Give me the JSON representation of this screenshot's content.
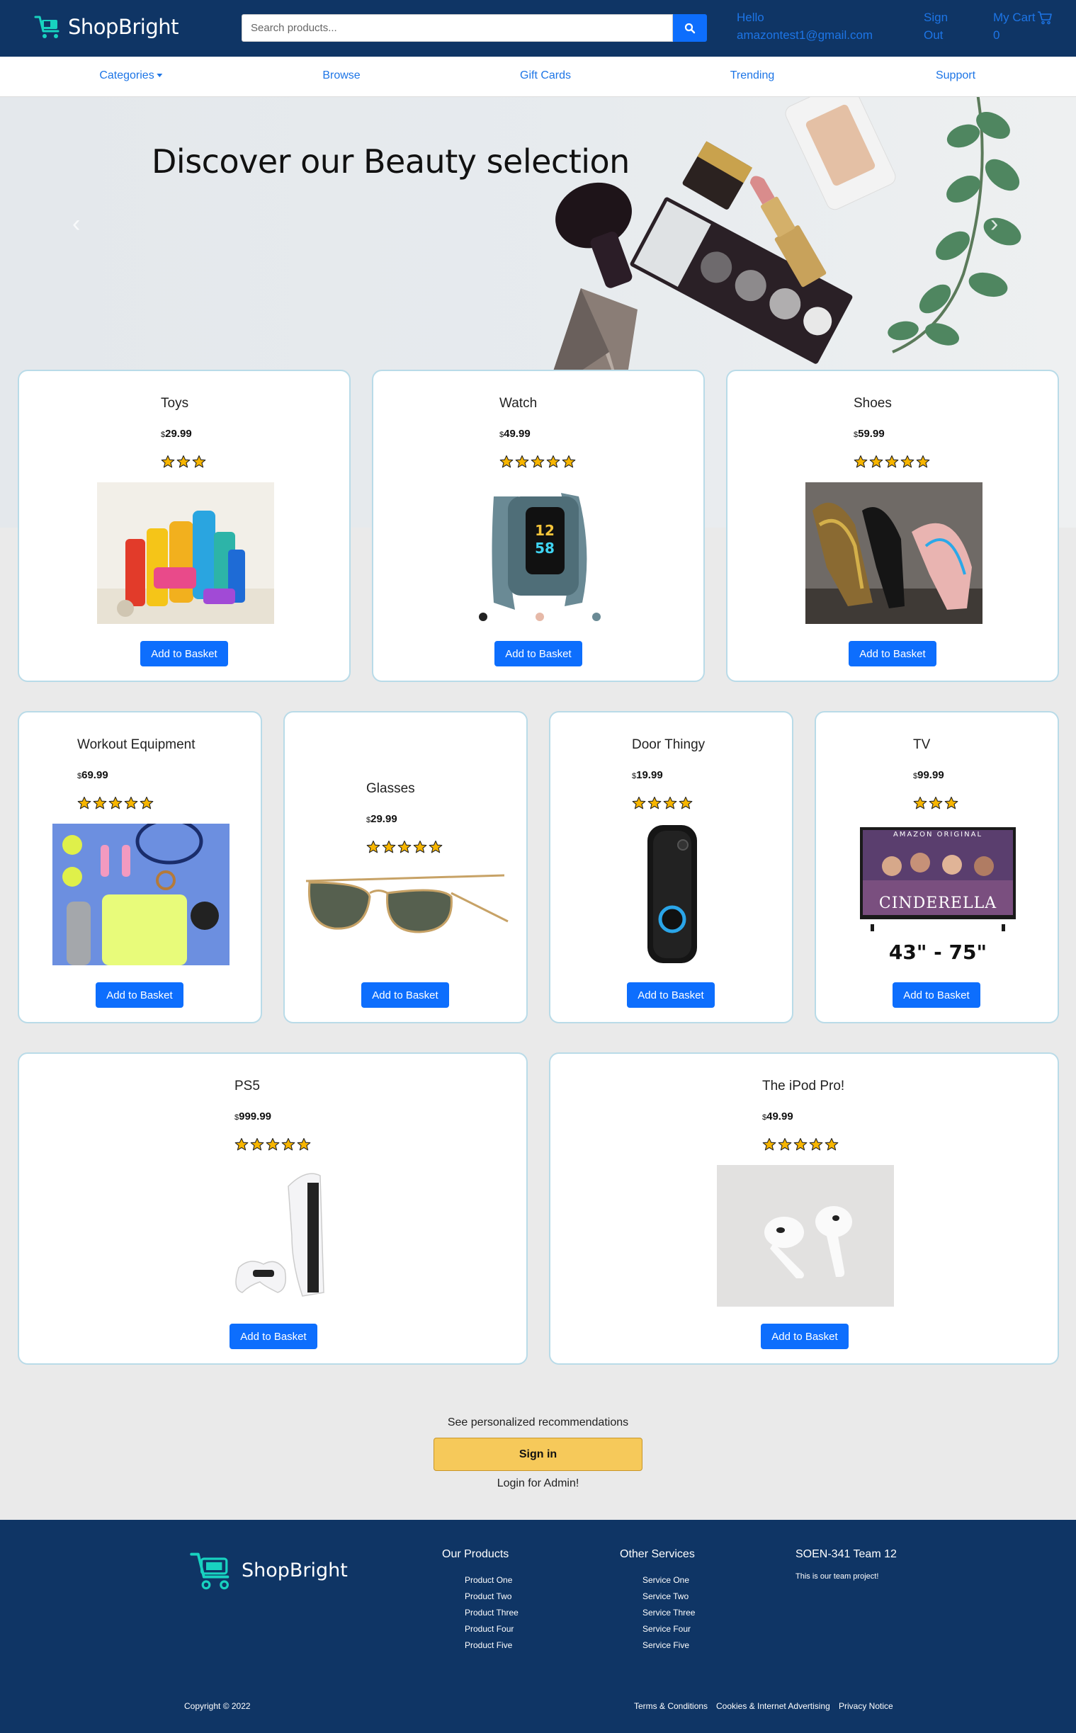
{
  "header": {
    "brand": "ShopBright",
    "search_placeholder": "Search products...",
    "hello_line1": "Hello",
    "hello_line2": "amazontest1@gmail.com",
    "signout_line1": "Sign",
    "signout_line2": "Out",
    "cart_label": "My Cart",
    "cart_count": "0",
    "colors": {
      "bar": "#0f3565",
      "link": "#1d75e6",
      "button": "#0d6efd"
    }
  },
  "nav": {
    "items": [
      {
        "label": "Categories"
      },
      {
        "label": "Browse"
      },
      {
        "label": "Gift Cards"
      },
      {
        "label": "Trending"
      },
      {
        "label": "Support"
      }
    ]
  },
  "hero": {
    "title": "Discover our Beauty selection",
    "prev_icon": "chevron-left-icon",
    "next_icon": "chevron-right-icon"
  },
  "products": [
    {
      "title": "Toys",
      "currency": "$",
      "price": "29.99",
      "rating": 3,
      "button": "Add to Basket",
      "image": "toys-photo"
    },
    {
      "title": "Watch",
      "currency": "$",
      "price": "49.99",
      "rating": 5,
      "button": "Add to Basket",
      "image": "watch-photo"
    },
    {
      "title": "Shoes",
      "currency": "$",
      "price": "59.99",
      "rating": 5,
      "button": "Add to Basket",
      "image": "shoes-photo"
    },
    {
      "title": "Workout Equipment",
      "currency": "$",
      "price": "69.99",
      "rating": 5,
      "button": "Add to Basket",
      "image": "workout-photo"
    },
    {
      "title": "Glasses",
      "currency": "$",
      "price": "29.99",
      "rating": 5,
      "button": "Add to Basket",
      "image": "glasses-photo"
    },
    {
      "title": "Door Thingy",
      "currency": "$",
      "price": "19.99",
      "rating": 4,
      "button": "Add to Basket",
      "image": "doorbell-photo"
    },
    {
      "title": "TV",
      "currency": "$",
      "price": "99.99",
      "rating": 3,
      "button": "Add to Basket",
      "image": "tv-photo",
      "image_caption": "43\" - 75\"",
      "image_banner": "AMAZON ORIGINAL",
      "image_movie": "CINDERELLA"
    },
    {
      "title": "PS5",
      "currency": "$",
      "price": "999.99",
      "rating": 5,
      "button": "Add to Basket",
      "image": "ps5-photo"
    },
    {
      "title": "The iPod Pro!",
      "currency": "$",
      "price": "49.99",
      "rating": 5,
      "button": "Add to Basket",
      "image": "airpods-photo"
    }
  ],
  "recommendations": {
    "text": "See personalized recommendations",
    "signin_label": "Sign in",
    "admin_text": "Login for Admin!"
  },
  "footer": {
    "brand": "ShopBright",
    "products_heading": "Our Products",
    "products": [
      "Product One",
      "Product Two",
      "Product Three",
      "Product Four",
      "Product Five"
    ],
    "services_heading": "Other Services",
    "services": [
      "Service One",
      "Service Two",
      "Service Three",
      "Service Four",
      "Service Five"
    ],
    "team_heading": "SOEN-341 Team 12",
    "team_text": "This is our team project!",
    "copyright": "Copyright © 2022",
    "legal": [
      "Terms & Conditions",
      "Cookies & Internet Advertising",
      "Privacy Notice"
    ]
  }
}
